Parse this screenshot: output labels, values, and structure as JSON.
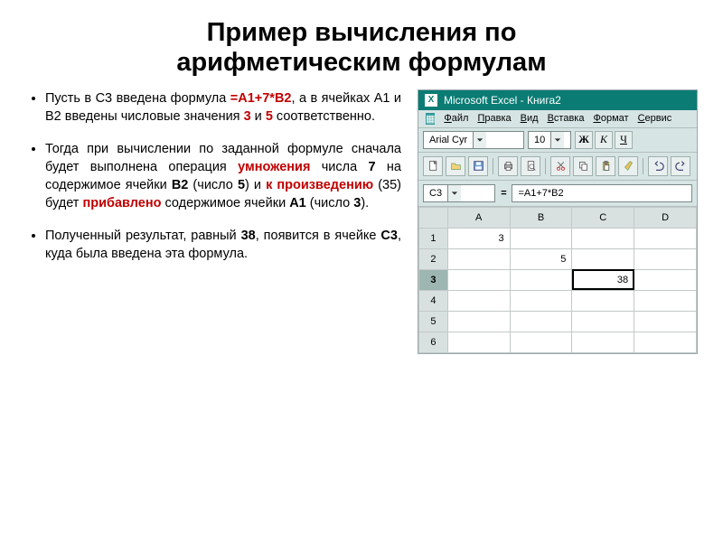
{
  "title_line1": "Пример вычисления по",
  "title_line2": "арифметическим формулам",
  "bullets": {
    "b1": {
      "t1": "Пусть в C3 введена формула ",
      "f1": "=A1+7*B2",
      "t2": ", а в ячейках A1 и B2 введены числовые значения ",
      "v1": "3",
      "t3": " и ",
      "v2": "5",
      "t4": " соответственно."
    },
    "b2": {
      "t1": "Тогда при вычислении по заданной формуле сначала будет выполнена операция ",
      "mul": "умножения",
      "t2": " числа ",
      "seven": "7",
      "t3": " на содержимое ячейки ",
      "bB2": "B2",
      "t4": " (число ",
      "five": "5",
      "t5": ") и ",
      "prod": "к произведению",
      "t6": " (35) будет ",
      "add": "прибавлено",
      "t7": " содержимое ячейки ",
      "bA1": "A1",
      "t8": " (число ",
      "three": "3",
      "t9": ")."
    },
    "b3": {
      "t1": "Полученный результат, равный ",
      "r": "38",
      "t2": ", появится в ячейке ",
      "c3": "C3",
      "t3": ", куда была введена эта формула."
    }
  },
  "excel": {
    "app_title": "Microsoft Excel - Книга2",
    "menu": [
      "Файл",
      "Правка",
      "Вид",
      "Вставка",
      "Формат",
      "Сервис"
    ],
    "font_name": "Arial Cyr",
    "font_size": "10",
    "bold": "Ж",
    "italic": "К",
    "underline": "Ч",
    "name_box": "C3",
    "formula": "=A1+7*B2",
    "cols": [
      "A",
      "B",
      "C",
      "D"
    ],
    "rows": [
      "1",
      "2",
      "3",
      "4",
      "5",
      "6"
    ],
    "cells": {
      "A1": "3",
      "B2": "5",
      "C3": "38"
    },
    "selected_col": "C",
    "selected_row": "3"
  }
}
